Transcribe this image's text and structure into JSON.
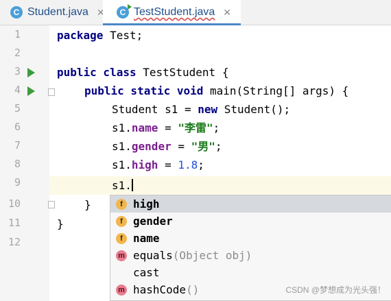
{
  "tabs": [
    {
      "label": "Student.java",
      "icon": "C",
      "close": "✕"
    },
    {
      "label": "TestStudent.java",
      "icon": "C",
      "close": "✕"
    }
  ],
  "line_numbers": [
    "1",
    "2",
    "3",
    "4",
    "5",
    "6",
    "7",
    "8",
    "9",
    "10",
    "11",
    "12"
  ],
  "code": {
    "l1_kw": "package",
    "l1_rest": " Test;",
    "l3_kw": "public class",
    "l3_rest": " TestStudent {",
    "l4_kw": "public static void",
    "l4_rest": " main(String[] args) {",
    "l5_a": "Student s1 = ",
    "l5_kw": "new",
    "l5_b": " Student();",
    "l6_a": "s1.",
    "l6_fld": "name",
    "l6_b": " = ",
    "l6_str": "\"李雷\"",
    "l6_c": ";",
    "l7_a": "s1.",
    "l7_fld": "gender",
    "l7_b": " = ",
    "l7_str": "\"男\"",
    "l7_c": ";",
    "l8_a": "s1.",
    "l8_fld": "high",
    "l8_b": " = ",
    "l8_num": "1.8",
    "l8_c": ";",
    "l9_a": "s1.",
    "l10": "}",
    "l11": "}"
  },
  "completion": [
    {
      "badge": "f",
      "name": "high",
      "sig": ""
    },
    {
      "badge": "f",
      "name": "gender",
      "sig": ""
    },
    {
      "badge": "f",
      "name": "name",
      "sig": ""
    },
    {
      "badge": "m",
      "name": "equals",
      "sig": "(Object obj)"
    },
    {
      "badge": "",
      "name": "cast",
      "sig": ""
    },
    {
      "badge": "m",
      "name": "hashCode",
      "sig": "()"
    }
  ],
  "watermark": "CSDN @梦想成为光头强！",
  "colors": {
    "keyword": "#000080",
    "field": "#7a1f8e",
    "string": "#1c7a1c",
    "number": "#1f4fdb",
    "run": "#3c9b3c"
  }
}
